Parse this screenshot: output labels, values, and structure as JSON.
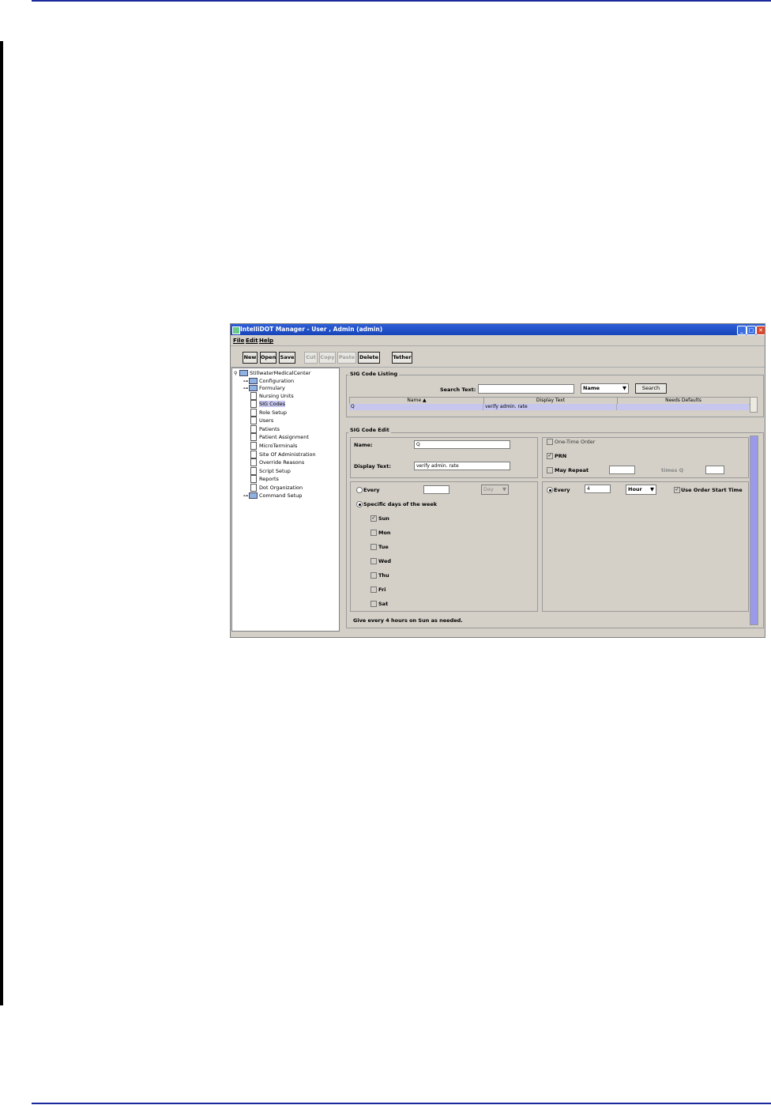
{
  "window": {
    "title": "IntelliDOT Manager - User , Admin (admin)",
    "controls": [
      "_",
      "□",
      "✕"
    ]
  },
  "menu": {
    "file": "File",
    "edit": "Edit",
    "help": "Help"
  },
  "toolbar": {
    "new": "New",
    "open": "Open",
    "save": "Save",
    "cut": "Cut",
    "copy": "Copy",
    "paste": "Paste",
    "delete": "Delete",
    "tether": "Tether"
  },
  "tree": {
    "root": "StillwaterMedicalCenter",
    "items": [
      {
        "label": "Configuration"
      },
      {
        "label": "Formulary"
      },
      {
        "label": "Nursing Units"
      },
      {
        "label": "SIG Codes"
      },
      {
        "label": "Role Setup"
      },
      {
        "label": "Users"
      },
      {
        "label": "Patients"
      },
      {
        "label": "Patient Assignment"
      },
      {
        "label": "MicroTerminals"
      },
      {
        "label": "Site Of Administration"
      },
      {
        "label": "Override Reasons"
      },
      {
        "label": "Script Setup"
      },
      {
        "label": "Reports"
      },
      {
        "label": "Dot Organization"
      },
      {
        "label": "Command Setup"
      }
    ]
  },
  "listing": {
    "title": "SIG Code Listing",
    "search_label": "Search Text:",
    "search_value": "",
    "search_by": "Name",
    "search_button": "Search",
    "columns": [
      "Name ▲",
      "Display Text",
      "Needs Defaults"
    ],
    "rows": [
      [
        "Q",
        "verify admin. rate",
        ""
      ]
    ]
  },
  "edit": {
    "title": "SIG Code Edit",
    "name_label": "Name:",
    "name_value": "Q",
    "display_label": "Display Text:",
    "display_value": "verify admin. rate",
    "one_time_label": "One-Time Order",
    "prn_label": "PRN",
    "prn_check": "✓",
    "may_repeat_label": "May Repeat",
    "times_q_label": "times Q",
    "every_left_label": "Every",
    "every_left_unit": "Day",
    "specific_days_label": "Specific days of the week",
    "days": [
      "Sun",
      "Mon",
      "Tue",
      "Wed",
      "Thu",
      "Fri",
      "Sat"
    ],
    "sun_check": "✓",
    "every_right_label": "Every",
    "every_right_value": "4",
    "every_right_unit": "Hour",
    "use_start_label": "Use Order Start Time",
    "use_start_check": "✓",
    "summary": "Give every 4 hours on Sun as needed."
  },
  "colors": {
    "rule": "#1a2a9e",
    "titlebar": "#1845b9",
    "selection": "#c6c6ef",
    "panel": "#d4d0c8"
  }
}
